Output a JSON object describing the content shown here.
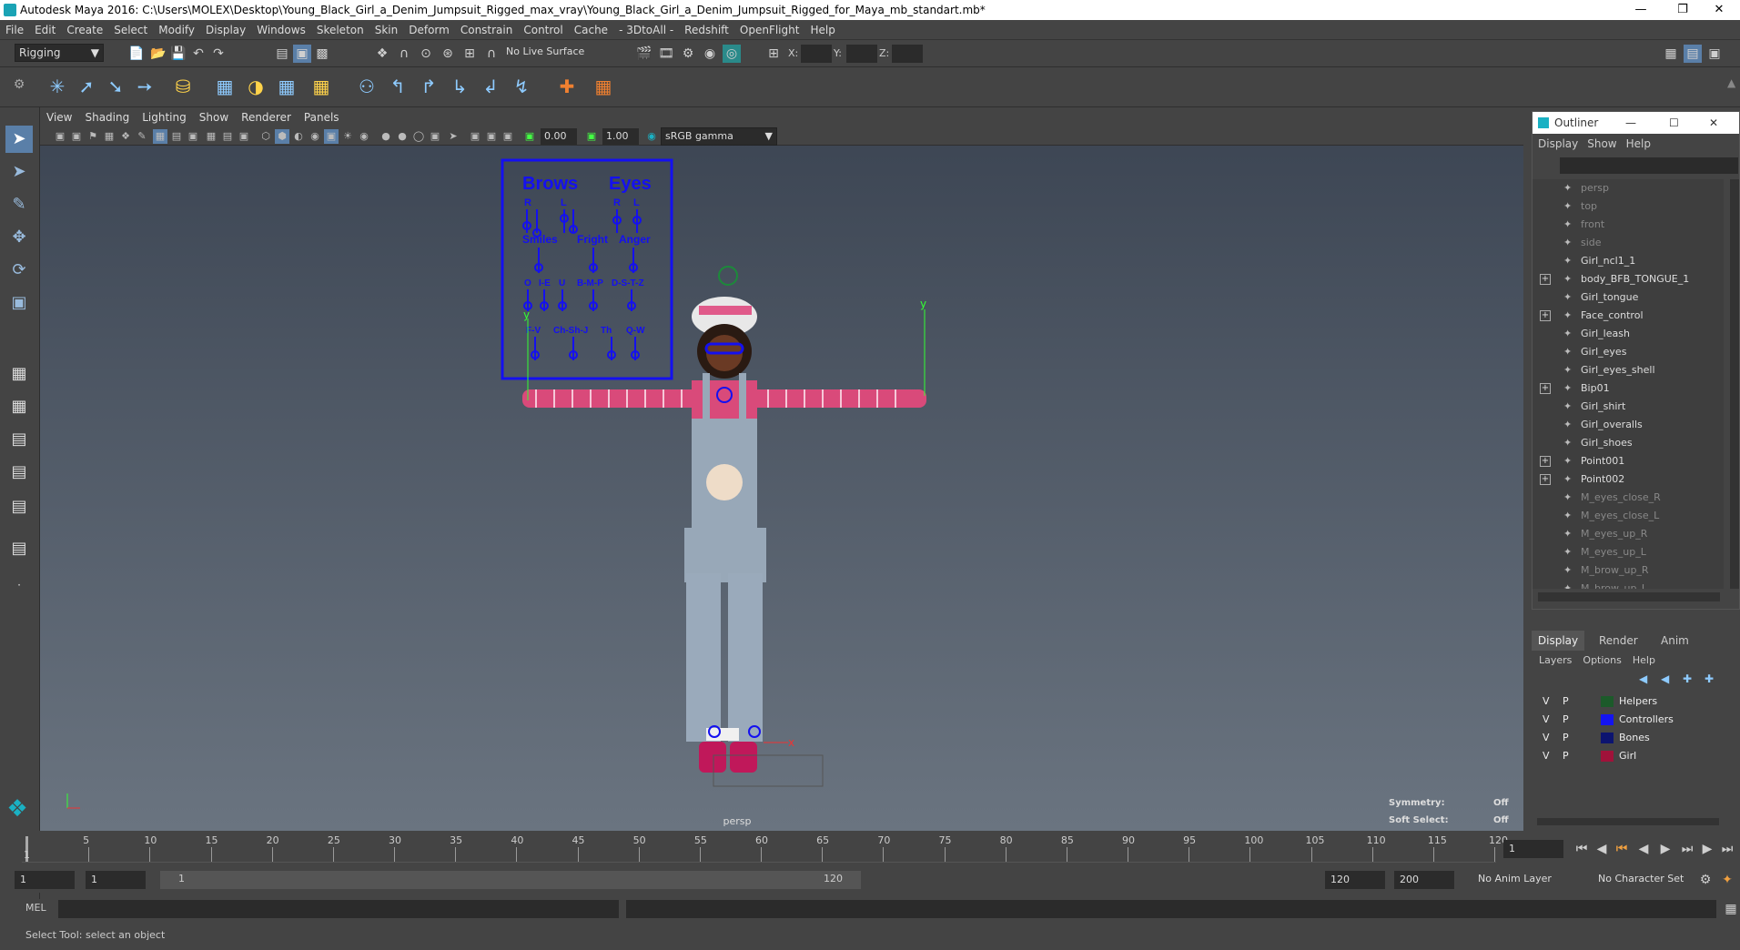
{
  "title": "Autodesk Maya 2016: C:\\Users\\MOLEX\\Desktop\\Young_Black_Girl_a_Denim_Jumpsuit_Rigged_max_vray\\Young_Black_Girl_a_Denim_Jumpsuit_Rigged_for_Maya_mb_standart.mb*",
  "menu": [
    "File",
    "Edit",
    "Create",
    "Select",
    "Modify",
    "Display",
    "Windows",
    "Skeleton",
    "Skin",
    "Deform",
    "Constrain",
    "Control",
    "Cache",
    "- 3DtoAll -",
    "Redshift",
    "OpenFlight",
    "Help"
  ],
  "status": {
    "mode": "Rigging",
    "live_surface": "No Live Surface",
    "x_label": "X:",
    "y_label": "Y:",
    "z_label": "Z:"
  },
  "viewport": {
    "menu": [
      "View",
      "Shading",
      "Lighting",
      "Show",
      "Renderer",
      "Panels"
    ],
    "exposure": "0.00",
    "gamma": "1.00",
    "colorspace": "sRGB gamma",
    "camera": "persp",
    "symmetry_label": "Symmetry:",
    "symmetry_value": "Off",
    "softselect_label": "Soft Select:",
    "softselect_value": "Off"
  },
  "face_panel": {
    "brows": "Brows",
    "eyes": "Eyes",
    "r1": "R",
    "l1": "L",
    "r2": "R",
    "l2": "L",
    "smile": "Smiles",
    "fright": "Fright",
    "anger": "Anger",
    "o": "O",
    "ie": "I-E",
    "u": "U",
    "bmp": "B-M-P",
    "dstz": "D-S-T-Z",
    "fv": "F-V",
    "chshj": "Ch-Sh-J",
    "th": "Th",
    "qw": "Q-W",
    "axis_y": "y",
    "axis_x": "x"
  },
  "outliner": {
    "title": "Outliner",
    "menu": [
      "Display",
      "Show",
      "Help"
    ],
    "items": [
      {
        "label": "persp",
        "expand": false,
        "dim": true
      },
      {
        "label": "top",
        "expand": false,
        "dim": true
      },
      {
        "label": "front",
        "expand": false,
        "dim": true
      },
      {
        "label": "side",
        "expand": false,
        "dim": true
      },
      {
        "label": "Girl_ncl1_1",
        "expand": false,
        "dim": false
      },
      {
        "label": "body_BFB_TONGUE_1",
        "expand": true,
        "dim": false
      },
      {
        "label": "Girl_tongue",
        "expand": false,
        "dim": false
      },
      {
        "label": "Face_control",
        "expand": true,
        "dim": false
      },
      {
        "label": "Girl_leash",
        "expand": false,
        "dim": false
      },
      {
        "label": "Girl_eyes",
        "expand": false,
        "dim": false
      },
      {
        "label": "Girl_eyes_shell",
        "expand": false,
        "dim": false
      },
      {
        "label": "Bip01",
        "expand": true,
        "dim": false
      },
      {
        "label": "Girl_shirt",
        "expand": false,
        "dim": false
      },
      {
        "label": "Girl_overalls",
        "expand": false,
        "dim": false
      },
      {
        "label": "Girl_shoes",
        "expand": false,
        "dim": false
      },
      {
        "label": "Point001",
        "expand": true,
        "dim": false
      },
      {
        "label": "Point002",
        "expand": true,
        "dim": false
      },
      {
        "label": "M_eyes_close_R",
        "expand": false,
        "dim": true
      },
      {
        "label": "M_eyes_close_L",
        "expand": false,
        "dim": true
      },
      {
        "label": "M_eyes_up_R",
        "expand": false,
        "dim": true
      },
      {
        "label": "M_eyes_up_L",
        "expand": false,
        "dim": true
      },
      {
        "label": "M_brow_up_R",
        "expand": false,
        "dim": true
      },
      {
        "label": "M_brow_up_L",
        "expand": false,
        "dim": true
      }
    ]
  },
  "layers": {
    "tabs": [
      "Display",
      "Render",
      "Anim"
    ],
    "menu": [
      "Layers",
      "Options",
      "Help"
    ],
    "rows": [
      {
        "v": "V",
        "p": "P",
        "name": "Helpers",
        "color": "#1c5a2a"
      },
      {
        "v": "V",
        "p": "P",
        "name": "Controllers",
        "color": "#1414f0"
      },
      {
        "v": "V",
        "p": "P",
        "name": "Bones",
        "color": "#0c1470"
      },
      {
        "v": "V",
        "p": "P",
        "name": "Girl",
        "color": "#a0123a"
      }
    ]
  },
  "timeline": {
    "ticks": [
      "5",
      "10",
      "15",
      "20",
      "25",
      "30",
      "35",
      "40",
      "45",
      "50",
      "55",
      "60",
      "65",
      "70",
      "75",
      "80",
      "85",
      "90",
      "95",
      "100",
      "105",
      "110",
      "115",
      "120"
    ],
    "start_label": "1",
    "current_frame": "1"
  },
  "range": {
    "start": "1",
    "start2": "1",
    "slider_start": "1",
    "slider_end": "120",
    "end": "120",
    "end2": "200",
    "anim_layer": "No Anim Layer",
    "char_set": "No Character Set"
  },
  "cmd": {
    "label": "MEL"
  },
  "help": "Select Tool: select an object"
}
